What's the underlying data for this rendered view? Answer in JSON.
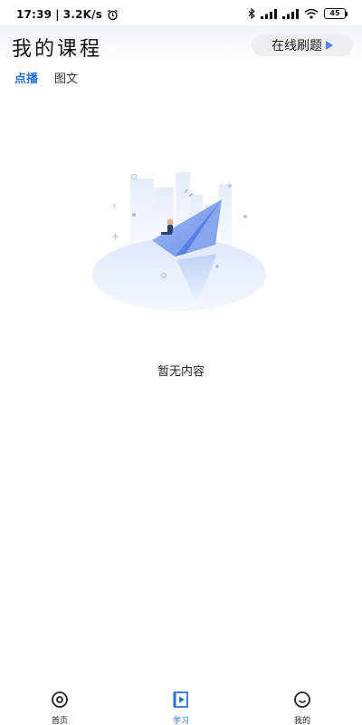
{
  "status_bar": {
    "time": "17:39",
    "network_speed": "3.2K/s",
    "battery": "45",
    "icons": [
      "alarm-icon",
      "bluetooth-icon",
      "signal-icon",
      "wifi-icon",
      "battery-icon"
    ]
  },
  "header": {
    "title": "我的课程",
    "practice_button": "在线刷题"
  },
  "tabs": [
    {
      "label": "点播",
      "active": true
    },
    {
      "label": "图文",
      "active": false
    }
  ],
  "empty_state": {
    "message": "暂无内容",
    "illustration": "paper-plane-illustration"
  },
  "bottom_nav": [
    {
      "label": "首页",
      "icon": "home-icon",
      "active": false
    },
    {
      "label": "学习",
      "icon": "study-icon",
      "active": true
    },
    {
      "label": "我的",
      "icon": "profile-icon",
      "active": false
    }
  ],
  "colors": {
    "accent": "#2a6fd6",
    "header_bg": "#f0f4fb",
    "button_bg": "#eceef2"
  }
}
